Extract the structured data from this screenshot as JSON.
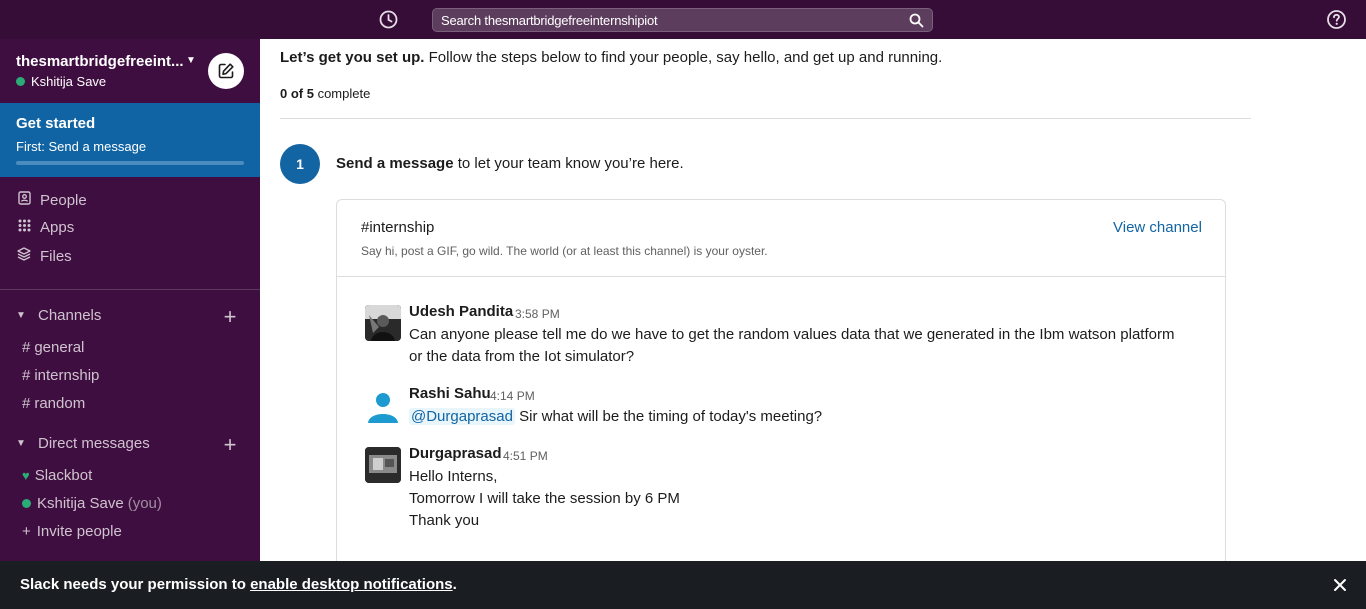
{
  "topbar": {
    "search_text": "Search thesmartbridgefreeinternshipiot",
    "history_icon": "clock-icon",
    "help_icon": "question-circle-icon",
    "bg_color": "#350d36"
  },
  "sidebar": {
    "workspace_name": "thesmartbridgefreeint...",
    "user_name": "Kshitija Save",
    "get_started": {
      "title": "Get started",
      "subtitle": "First: Send a message"
    },
    "nav": [
      {
        "label": "People",
        "icon": "people-icon"
      },
      {
        "label": "Apps",
        "icon": "apps-grid-icon"
      },
      {
        "label": "Files",
        "icon": "files-layers-icon"
      }
    ],
    "channels_header": "Channels",
    "channels": [
      {
        "hash": "#",
        "name": "general"
      },
      {
        "hash": "#",
        "name": "internship"
      },
      {
        "hash": "#",
        "name": "random"
      }
    ],
    "dm_header": "Direct messages",
    "dms": [
      {
        "name": "Slackbot",
        "you": ""
      },
      {
        "name": "Kshitija Save",
        "you": "(you)"
      }
    ],
    "invite": {
      "plus": "+",
      "label": "Invite people"
    },
    "bg_color": "#3f0e40",
    "accent_color": "#1164a3"
  },
  "main": {
    "intro_bold": "Let’s get you set up.",
    "intro_rest": " Follow the steps below to find your people, say hello, and get up and running.",
    "progress_done": "0 of 5",
    "progress_label": " complete",
    "progress_value": 0,
    "progress_total": 5,
    "step_number": "1",
    "step_bold": "Send a message",
    "step_rest": " to let your team know you’re here.",
    "card": {
      "channel": "#internship",
      "description": "Say hi, post a GIF, go wild. The world (or at least this channel) is your oyster.",
      "view_channel": "View channel"
    },
    "messages": [
      {
        "author": "Udesh Pandita",
        "time": "3:58 PM",
        "lines": [
          "Can anyone please tell me do we have to get the random values data that we generated in the Ibm watson platform",
          "or the data from the Iot simulator?"
        ]
      },
      {
        "author": "Rashi Sahu",
        "time": "4:14 PM",
        "mention": "@Durgaprasad",
        "lines": [
          " Sir what will be the timing of today's meeting?"
        ]
      },
      {
        "author": "Durgaprasad",
        "time": "4:51 PM",
        "lines": [
          "Hello Interns,",
          "Tomorrow I will take the session by 6 PM",
          "Thank you"
        ]
      }
    ]
  },
  "banner": {
    "prefix": "Slack needs your permission to ",
    "link": "enable desktop notifications",
    "suffix": ".",
    "close_icon": "close-icon"
  }
}
